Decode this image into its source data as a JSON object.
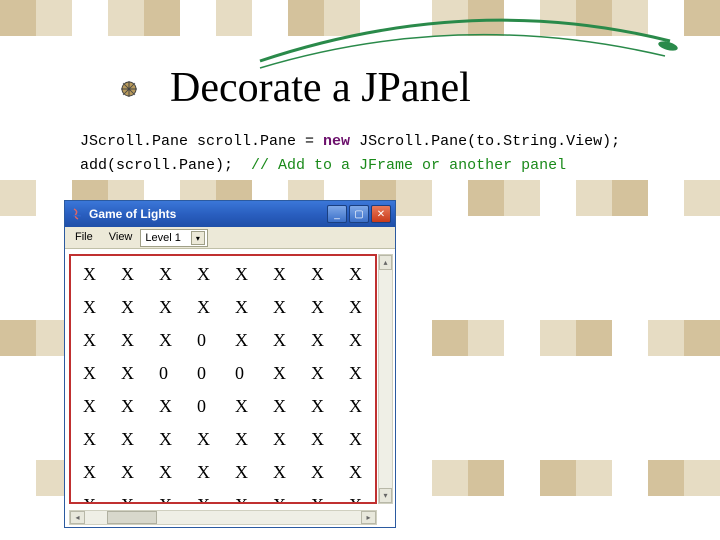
{
  "slide": {
    "title": "Decorate a JPanel"
  },
  "code": {
    "line1a": "JScroll.Pane scroll.Pane = ",
    "kw": "new",
    "line1b": " JScroll.Pane(to.String.View);",
    "line2a": "add(scroll.Pane);  ",
    "comment": "// Add to a JFrame or another panel"
  },
  "window": {
    "title": "Game of Lights",
    "btn_min": "_",
    "btn_max": "▢",
    "btn_close": "✕",
    "menu": {
      "file": "File",
      "view": "View",
      "level_value": "Level 1",
      "arrow": "▾"
    },
    "scroll": {
      "up": "▴",
      "down": "▾",
      "left": "◂",
      "right": "▸"
    },
    "grid_rows": [
      [
        "X",
        "X",
        "X",
        "X",
        "X",
        "X",
        "X",
        "X"
      ],
      [
        "X",
        "X",
        "X",
        "X",
        "X",
        "X",
        "X",
        "X"
      ],
      [
        "X",
        "X",
        "X",
        "0",
        "X",
        "X",
        "X",
        "X"
      ],
      [
        "X",
        "X",
        "0",
        "0",
        "0",
        "X",
        "X",
        "X"
      ],
      [
        "X",
        "X",
        "X",
        "0",
        "X",
        "X",
        "X",
        "X"
      ],
      [
        "X",
        "X",
        "X",
        "X",
        "X",
        "X",
        "X",
        "X"
      ],
      [
        "X",
        "X",
        "X",
        "X",
        "X",
        "X",
        "X",
        "X"
      ],
      [
        "X",
        "X",
        "X",
        "X",
        "X",
        "X",
        "X",
        "X"
      ]
    ]
  }
}
